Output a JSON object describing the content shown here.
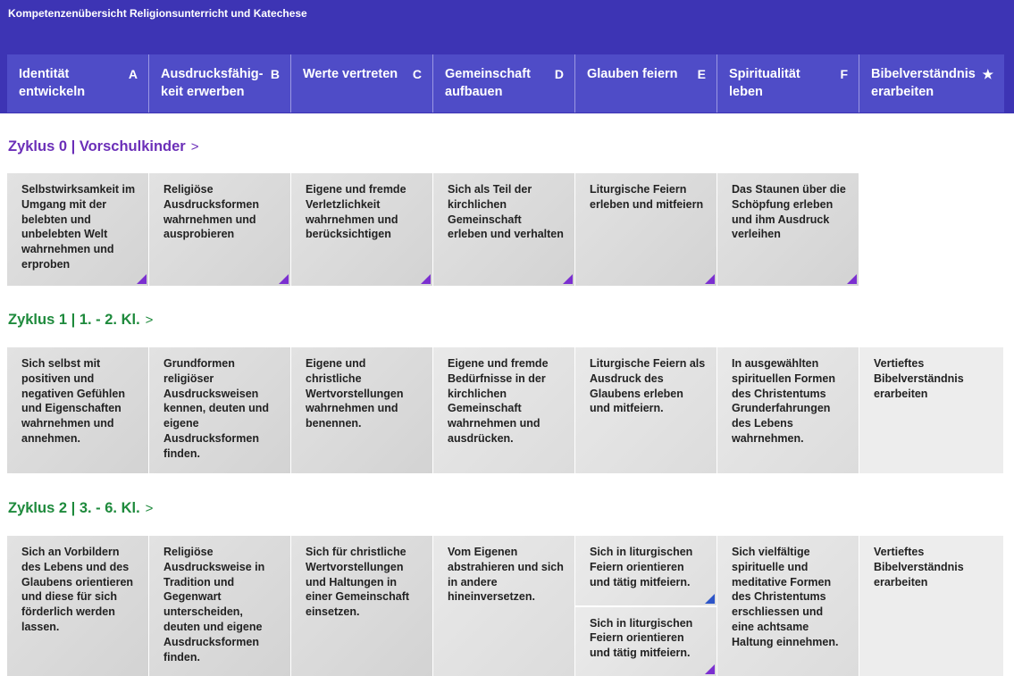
{
  "app": {
    "title": "Kompetenzenübersicht Religionsunterricht und Katechese"
  },
  "tabs": [
    {
      "label": "Identität entwickeln",
      "letter": "A"
    },
    {
      "label": "Ausdrucksfähig-keit erwerben",
      "letter": "B"
    },
    {
      "label": "Werte vertreten",
      "letter": "C"
    },
    {
      "label": "Gemeinschaft aufbauen",
      "letter": "D"
    },
    {
      "label": "Glauben feiern",
      "letter": "E"
    },
    {
      "label": "Spiritualität leben",
      "letter": "F"
    },
    {
      "label": "Bibelverständnis erarbeiten",
      "letter": "★"
    }
  ],
  "cycles": [
    {
      "title": "Zyklus 0 | Vorschulkinder",
      "chevron": ">",
      "color": "#6b2fb8",
      "cells": [
        "Selbstwirksamkeit im Umgang mit der belebten und unbelebten Welt wahrnehmen und erproben",
        "Religiöse Ausdrucksformen wahrnehmen und ausprobieren",
        "Eigene und fremde Verletzlichkeit wahrnehmen und berücksichtigen",
        "Sich als Teil der kirchlichen Gemeinschaft erleben und verhalten",
        "Liturgische Feiern erleben und mitfeiern",
        "Das Staunen über die Schöpfung erleben und ihm Ausdruck verleihen"
      ]
    },
    {
      "title": "Zyklus 1 | 1. - 2. Kl.",
      "chevron": ">",
      "color": "#1e8a3c",
      "cells": [
        "Sich selbst mit positiven und negativen Gefühlen und Eigenschaften wahrnehmen und annehmen.",
        "Grundformen religiöser Ausdrucksweisen kennen, deuten und eigene Ausdrucksformen finden.",
        "Eigene und christliche Wertvorstellungen wahrnehmen und benennen.",
        "Eigene und fremde Bedürfnisse in der kirchlichen Gemeinschaft wahrnehmen und ausdrücken.",
        "Liturgische Feiern als Ausdruck des Glaubens erleben und mitfeiern.",
        "In ausgewählten spirituellen Formen des Christentums Grunderfahrungen des Lebens wahrnehmen.",
        "Vertieftes Bibelverständnis erarbeiten"
      ]
    },
    {
      "title": "Zyklus 2 | 3. - 6. Kl.",
      "chevron": ">",
      "color": "#1e8a3c",
      "cells": [
        "Sich an Vorbildern des Lebens und des Glaubens orientieren und diese für sich förderlich werden lassen.",
        "Religiöse Ausdrucksweise in Tradition und Gegenwart unterscheiden, deuten und eigene Ausdrucksformen finden.",
        "Sich für christliche Wertvorstellungen und Haltungen in einer Gemeinschaft einsetzen.",
        "Vom Eigenen abstrahieren und sich in andere hineinversetzen.",
        "Sich in liturgischen Feiern orientieren und tätig mitfeiern.",
        "Sich in liturgischen Feiern orientieren und tätig mitfeiern.",
        "Sich vielfältige spirituelle und meditative Formen des Christentums erschliessen und eine achtsame Haltung einnehmen.",
        "Vertieftes Bibelverständnis erarbeiten"
      ]
    }
  ]
}
